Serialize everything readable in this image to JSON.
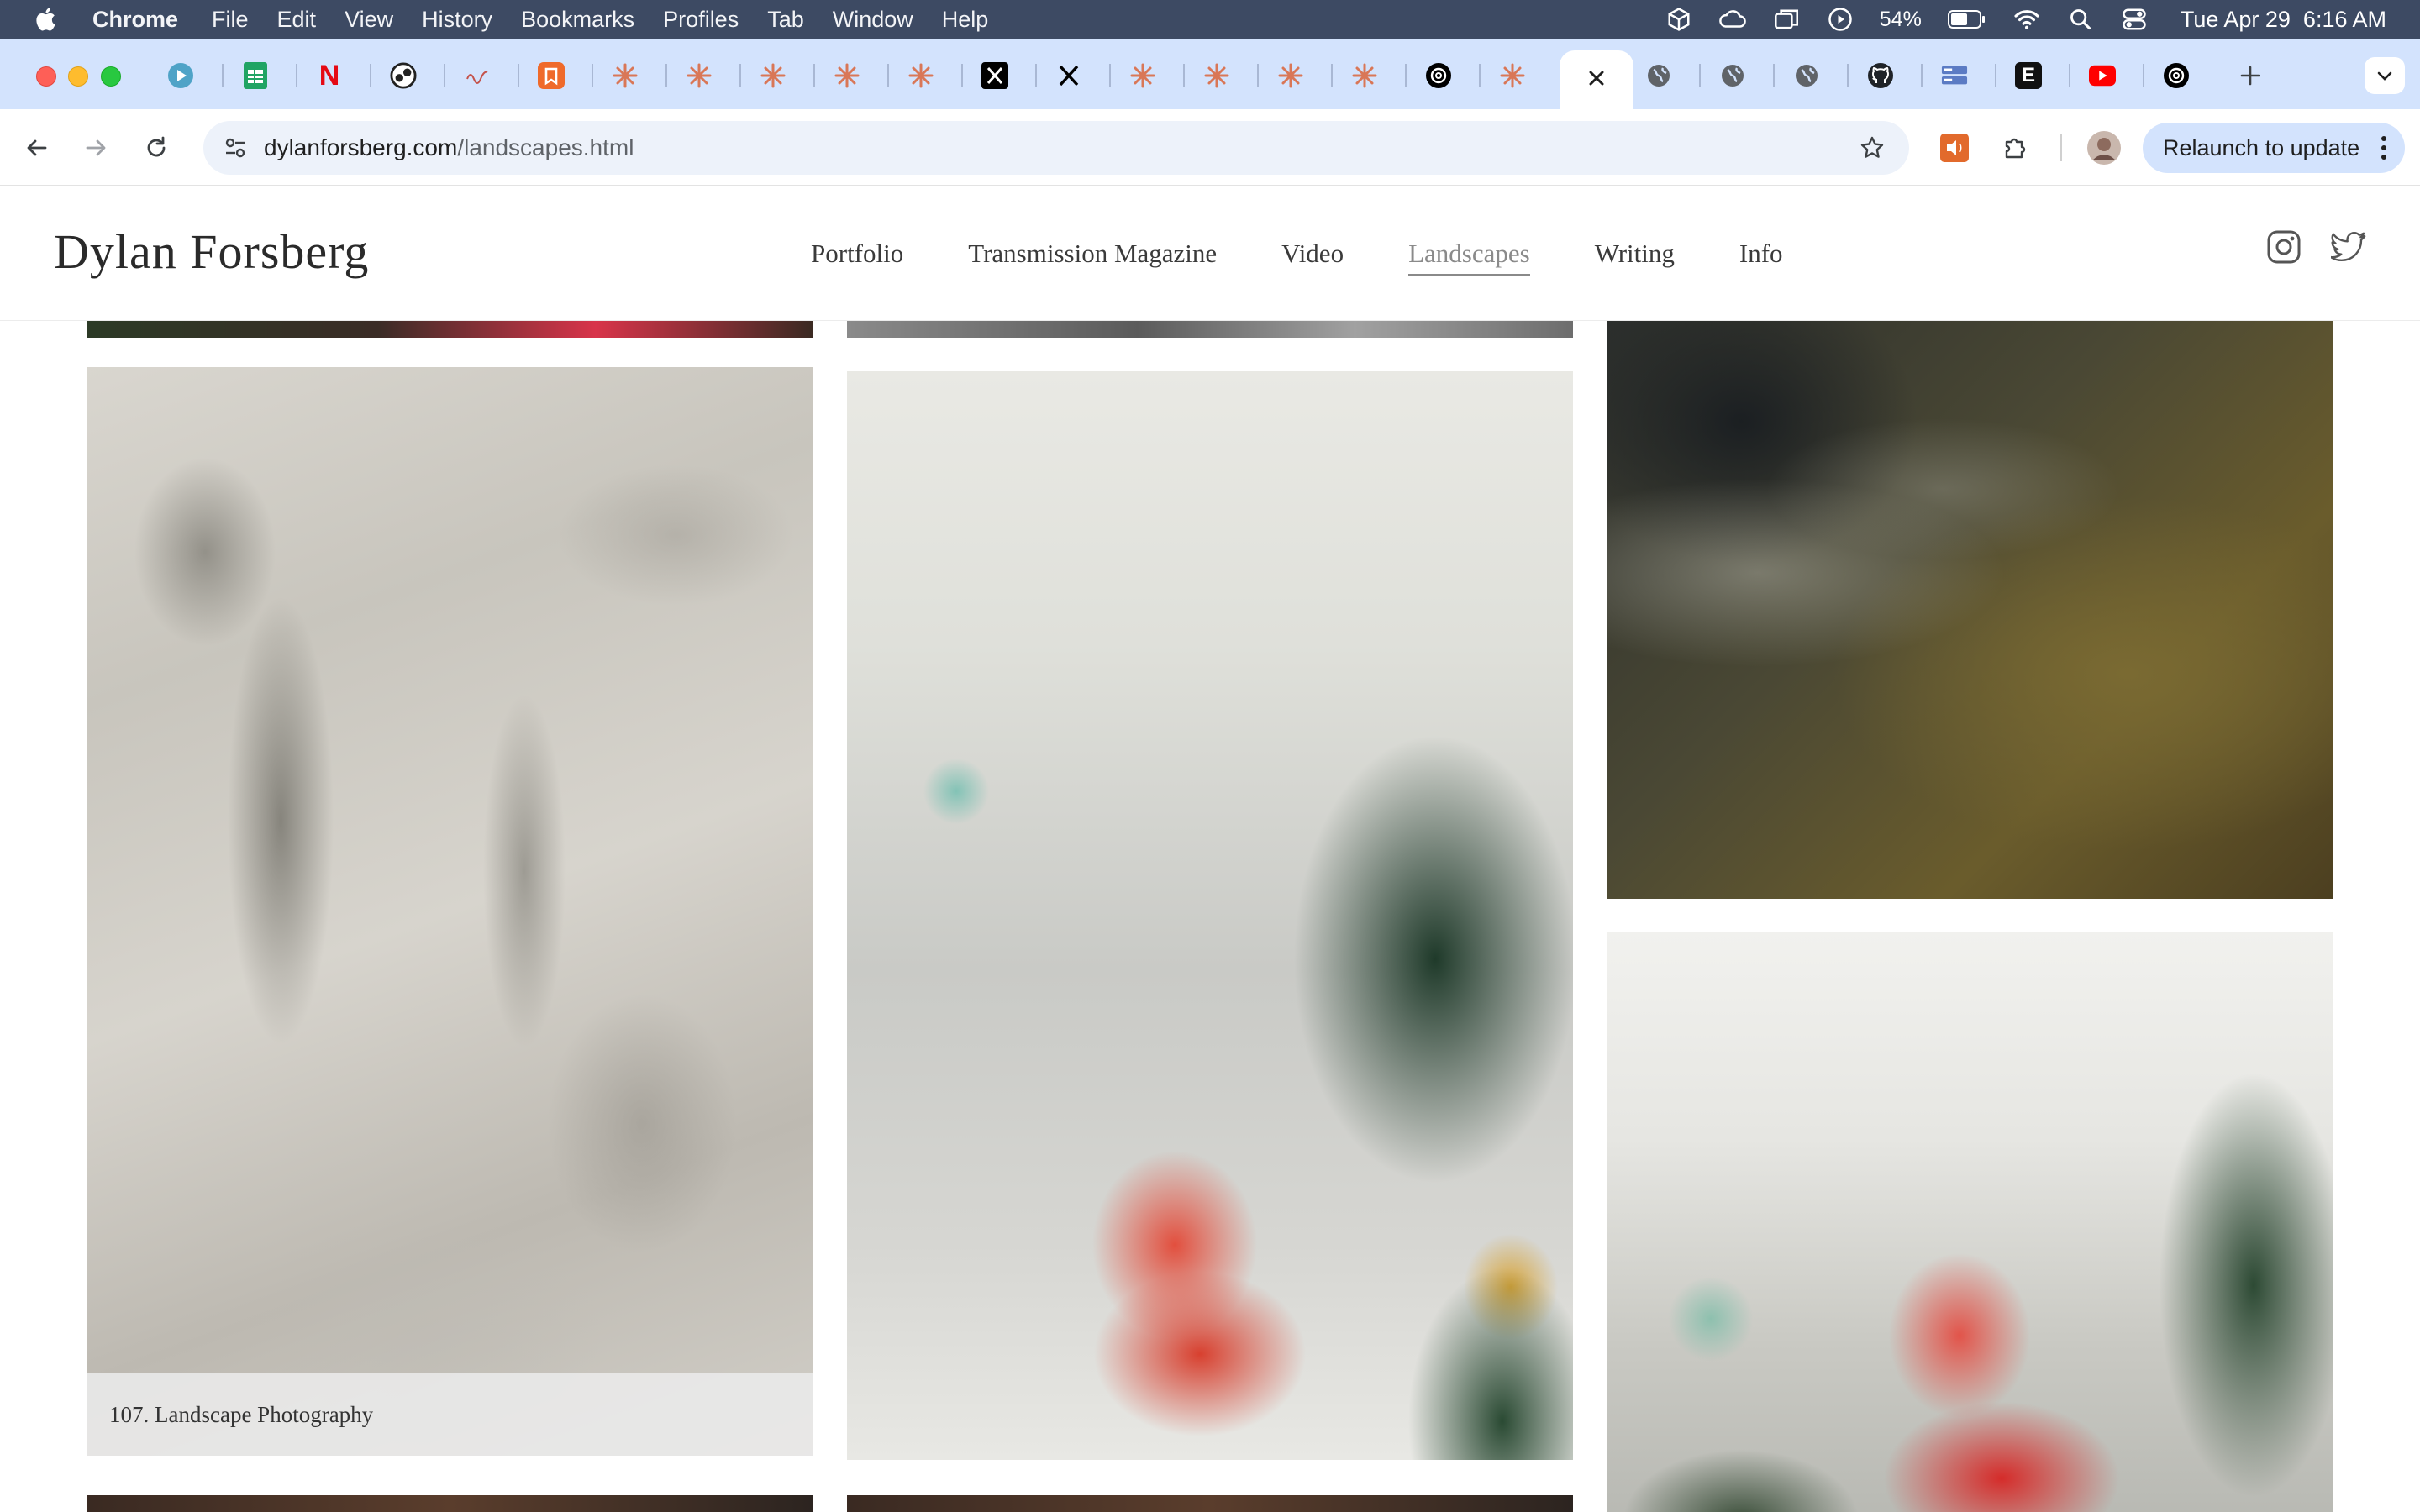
{
  "menubar": {
    "app": "Chrome",
    "items": [
      "File",
      "Edit",
      "View",
      "History",
      "Bookmarks",
      "Profiles",
      "Tab",
      "Window",
      "Help"
    ],
    "battery": "54%",
    "clock": "Tue Apr 29  6:16 AM"
  },
  "browser": {
    "url_host": "dylanforsberg.com",
    "url_path": "/landscapes.html",
    "relaunch_label": "Relaunch to update"
  },
  "site": {
    "logo": "Dylan Forsberg",
    "nav": [
      {
        "label": "Portfolio"
      },
      {
        "label": "Transmission Magazine"
      },
      {
        "label": "Video"
      },
      {
        "label": "Landscapes"
      },
      {
        "label": "Writing"
      },
      {
        "label": "Info"
      }
    ],
    "photo_caption": "107. Landscape Photography"
  }
}
